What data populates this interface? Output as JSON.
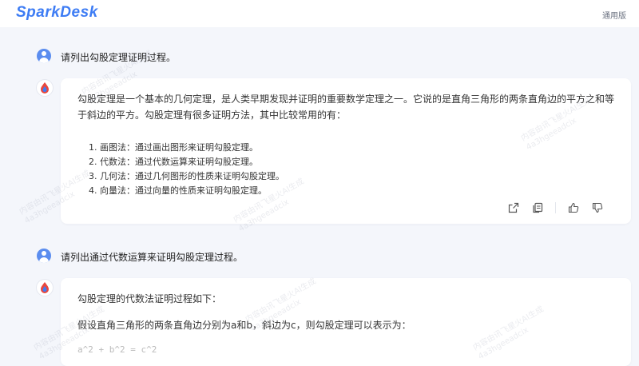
{
  "app": {
    "logo": "SparkDesk",
    "version_label": "通用版"
  },
  "messages": {
    "q1": "请列出勾股定理证明过程。",
    "a1": {
      "intro": "勾股定理是一个基本的几何定理，是人类早期发现并证明的重要数学定理之一。它说的是直角三角形的两条直角边的平方之和等于斜边的平方。勾股定理有很多证明方法，其中比较常用的有：",
      "items": [
        {
          "num": "1.",
          "text": "画图法：通过画出图形来证明勾股定理。"
        },
        {
          "num": "2.",
          "text": "代数法：通过代数运算来证明勾股定理。"
        },
        {
          "num": "3.",
          "text": "几何法：通过几何图形的性质来证明勾股定理。"
        },
        {
          "num": "4.",
          "text": "向量法：通过向量的性质来证明勾股定理。"
        }
      ]
    },
    "q2": "请列出通过代数运算来证明勾股定理过程。",
    "a2": {
      "line1": "勾股定理的代数法证明过程如下：",
      "line2": "假设直角三角形的两条直角边分别为a和b，斜边为c，则勾股定理可以表示为：",
      "formula": "a^2 + b^2 = c^2"
    }
  },
  "action_icons": [
    "share-icon",
    "copy-icon",
    "thumbs-up-icon",
    "thumbs-down-icon"
  ],
  "watermark": {
    "line1": "内容由讯飞星火AI生成",
    "line2": "4a3hgeeadcix"
  },
  "colors": {
    "accent": "#3d7cf4",
    "background": "#f4f6fb",
    "card": "#ffffff"
  }
}
